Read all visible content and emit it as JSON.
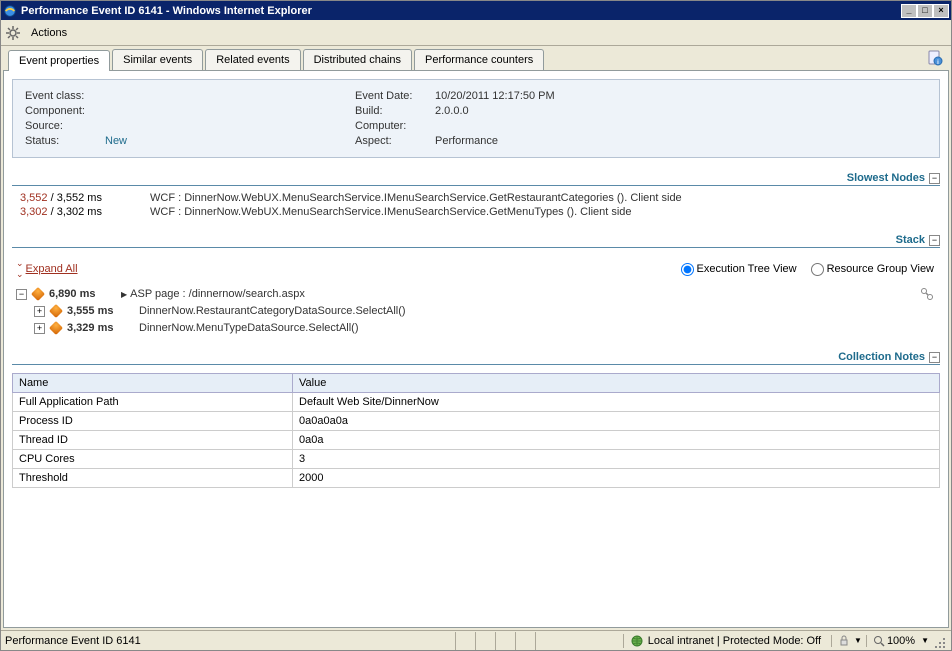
{
  "window": {
    "title": "Performance Event ID 6141 - Windows Internet Explorer"
  },
  "menu": {
    "actions": "Actions"
  },
  "tabs": {
    "event_properties": "Event properties",
    "similar_events": "Similar events",
    "related_events": "Related events",
    "distributed_chains": "Distributed chains",
    "performance_counters": "Performance counters"
  },
  "info": {
    "event_class_label": "Event class:",
    "event_class_value": "",
    "component_label": "Component:",
    "component_value": "",
    "source_label": "Source:",
    "source_value": "",
    "status_label": "Status:",
    "status_value": "New",
    "event_date_label": "Event Date:",
    "event_date_value": "10/20/2011 12:17:50 PM",
    "build_label": "Build:",
    "build_value": "2.0.0.0",
    "computer_label": "Computer:",
    "computer_value": "",
    "aspect_label": "Aspect:",
    "aspect_value": "Performance"
  },
  "sections": {
    "slowest": "Slowest Nodes",
    "stack": "Stack",
    "collection": "Collection Notes"
  },
  "slowest": {
    "rows": [
      {
        "t1": "3,552",
        "sep": " / ",
        "t2": "3,552 ms",
        "desc": "WCF : DinnerNow.WebUX.MenuSearchService.IMenuSearchService.GetRestaurantCategories (). Client side"
      },
      {
        "t1": "3,302",
        "sep": " / ",
        "t2": "3,302 ms",
        "desc": "WCF : DinnerNow.WebUX.MenuSearchService.IMenuSearchService.GetMenuTypes (). Client side"
      }
    ]
  },
  "stack": {
    "expand_all": "Expand All",
    "exec_view": "Execution Tree View",
    "resource_view": "Resource Group View",
    "rows": [
      {
        "indent": 0,
        "toggle": "-",
        "time": "6,890 ms",
        "label": "ASP page : /dinnernow/search.aspx",
        "arrow": true,
        "endicon": true
      },
      {
        "indent": 1,
        "toggle": "+",
        "time": "3,555 ms",
        "label": "DinnerNow.RestaurantCategoryDataSource.SelectAll()"
      },
      {
        "indent": 1,
        "toggle": "+",
        "time": "3,329 ms",
        "label": "DinnerNow.MenuTypeDataSource.SelectAll()"
      }
    ]
  },
  "collection": {
    "headers": {
      "name": "Name",
      "value": "Value"
    },
    "rows": [
      {
        "name": "Full Application Path",
        "value": "Default Web Site/DinnerNow"
      },
      {
        "name": "Process ID",
        "value": "0a0a0a0a"
      },
      {
        "name": "Thread ID",
        "value": "0a0a"
      },
      {
        "name": "CPU Cores",
        "value": "3"
      },
      {
        "name": "Threshold",
        "value": "2000"
      }
    ]
  },
  "status": {
    "left": "Performance Event ID 6141",
    "zone": "Local intranet | Protected Mode: Off",
    "zoom": "100%"
  }
}
